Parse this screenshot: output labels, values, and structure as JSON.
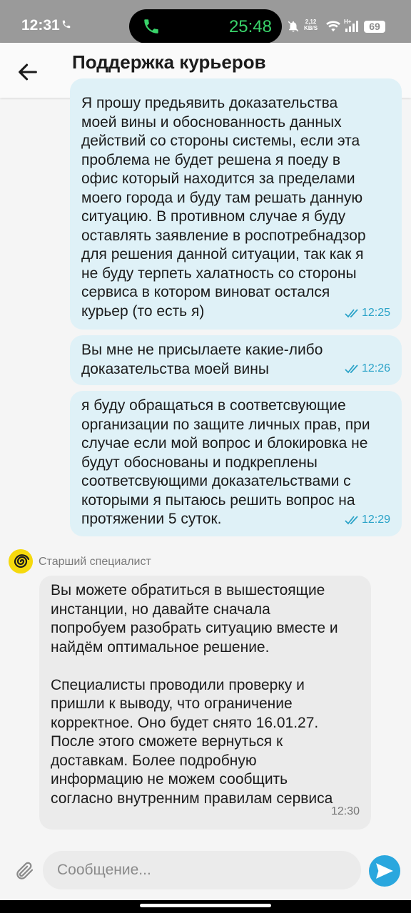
{
  "status_bar": {
    "time": "12:31",
    "call_timer": "25:48",
    "net_speed_value": "2,12",
    "net_speed_unit": "KB/S",
    "network_type": "H+",
    "battery": "69"
  },
  "header": {
    "title": "Поддержка курьеров",
    "back_icon": "arrow-left-icon"
  },
  "messages": [
    {
      "direction": "outgoing",
      "text": "Я прошу предьявить доказательства\nмоей вины и обоснованность данных\nдействий со стороны системы, если эта\nпроблема не будет решена я поеду в\nофис который находится за пределами\nмоего города и буду там решать данную\nситуацию. В противном случае я буду\nоставлять заявление в роспотребнадзор\nдля решения данной ситуации, так как я\nне буду терпеть халатность со стороны\nсервиса в котором виноват остался\nкурьер (то есть я)",
      "time": "12:25",
      "status": "read"
    },
    {
      "direction": "outgoing",
      "text": "Вы мне не присылаете какие-либо\nдоказательства моей вины",
      "time": "12:26",
      "status": "read"
    },
    {
      "direction": "outgoing",
      "text": "я буду обращаться в соответсвующие\nорганизации по защите личных прав, при\nслучае если мой вопрос и блокировка не\nбудут обоснованы и подкреплены\nсоответсвующими доказательствами с\nкоторыми я пытаюсь решить вопрос на\nпротяжении 5 суток.",
      "time": "12:29",
      "status": "read"
    },
    {
      "direction": "incoming",
      "sender": "Старший специалист",
      "text": "Вы можете обратиться в вышестоящие\nинстанции, но давайте сначала\nпопробуем разобрать ситуацию вместе и\nнайдём оптимальное решение.\n\nСпециалисты проводили проверку и\nпришли к выводу, что ограничение\nкорректное. Оно будет снято 16.01.27.\nПосле этого сможете вернуться к\nдоставкам. Более подробную\nинформацию не можем сообщить\nсогласно внутренним правилам сервиса",
      "time": "12:30"
    }
  ],
  "composer": {
    "placeholder": "Сообщение...",
    "value": "",
    "attach_icon": "paperclip-icon",
    "send_icon": "send-icon"
  },
  "colors": {
    "outgoing_bubble": "#dff1f7",
    "incoming_bubble": "#ebebeb",
    "accent": "#2aa3c8",
    "send_button": "#2aa7de",
    "avatar": "#f5d90d"
  }
}
